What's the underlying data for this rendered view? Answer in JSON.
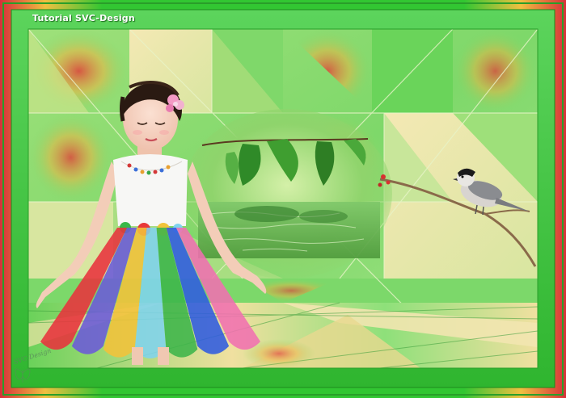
{
  "title": "Tutorial SVC-Design",
  "watermark": "SVC-Design",
  "colors": {
    "frame_green": "#39c639",
    "border_dark": "#1d8a1d",
    "accent_red": "#e0403a",
    "accent_yellow": "#f0d060",
    "panel_cream": "#f2e6b0",
    "light_green": "#8ee07a"
  },
  "dress_stripes": [
    "#e8323c",
    "#6b5ad8",
    "#f3c23a",
    "#7fd3ee",
    "#3cb54a",
    "#2f5be0",
    "#f06fb0"
  ]
}
